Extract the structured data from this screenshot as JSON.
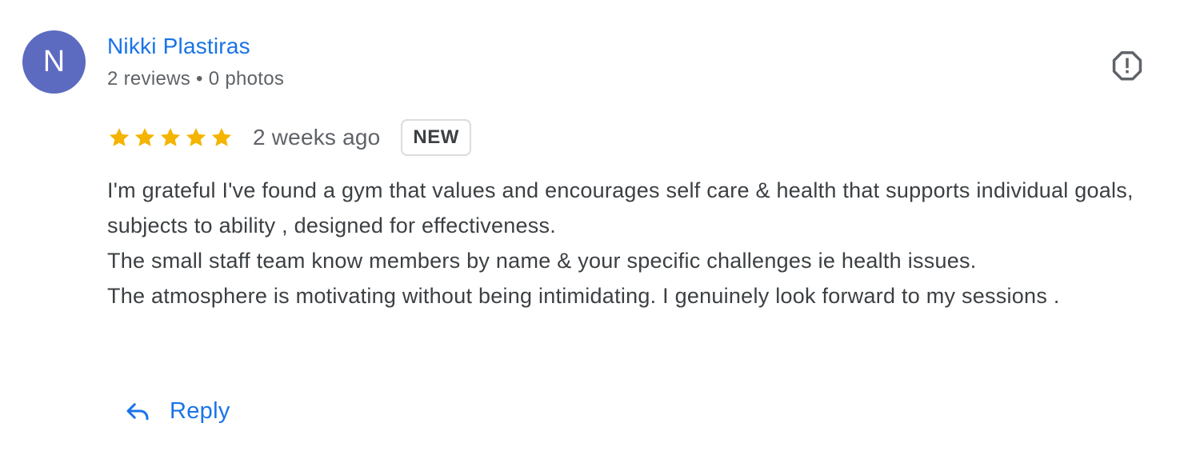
{
  "reviewer": {
    "avatar_letter": "N",
    "name": "Nikki Plastiras",
    "meta": "2 reviews • 0 photos"
  },
  "rating": {
    "stars": 5,
    "max_stars": 5,
    "date": "2 weeks ago",
    "badge": "NEW"
  },
  "review_text": [
    "I'm grateful I've found a gym that values and encourages self care & health that supports individual goals, subjects to ability , designed for effectiveness.",
    "The small staff team know members by name & your specific challenges ie health issues.",
    "The atmosphere is motivating without being intimidating. I genuinely look forward to my sessions ."
  ],
  "actions": {
    "reply_label": "Reply",
    "reply_icon": "reply-icon",
    "report_icon": "report-icon"
  },
  "colors": {
    "link_blue": "#1a73e8",
    "avatar_bg": "#5c6bc0",
    "star_gold": "#f4b400",
    "text": "#3c4043",
    "muted": "#5f6368"
  }
}
